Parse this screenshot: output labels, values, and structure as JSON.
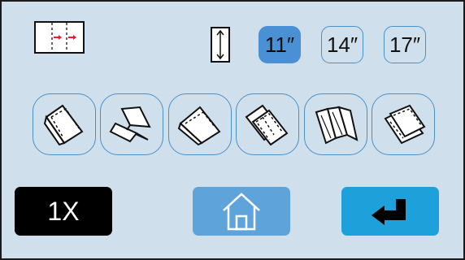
{
  "top_row": {
    "fold_indicator_icon": "fold-panels-with-arrows-icon",
    "length_icon": "vertical-length-arrow-icon",
    "sizes": [
      {
        "label": "11″",
        "selected": true
      },
      {
        "label": "14″",
        "selected": false
      },
      {
        "label": "17″",
        "selected": false
      }
    ]
  },
  "fold_types": [
    {
      "icon": "half-fold-icon"
    },
    {
      "icon": "z-fold-icon"
    },
    {
      "icon": "single-fold-icon"
    },
    {
      "icon": "double-parallel-fold-icon"
    },
    {
      "icon": "accordion-fold-icon"
    },
    {
      "icon": "tri-fold-icon"
    }
  ],
  "bottom_bar": {
    "copies_label": "1X",
    "home_icon": "home-icon",
    "enter_icon": "enter-arrow-icon"
  },
  "colors": {
    "screen_background": "#cfe0ec",
    "selected_size": "#4a90d4",
    "button_border": "#4a90c8",
    "home_button": "#5ea4da",
    "enter_button": "#1ea0db",
    "copies_button": "#000000"
  }
}
